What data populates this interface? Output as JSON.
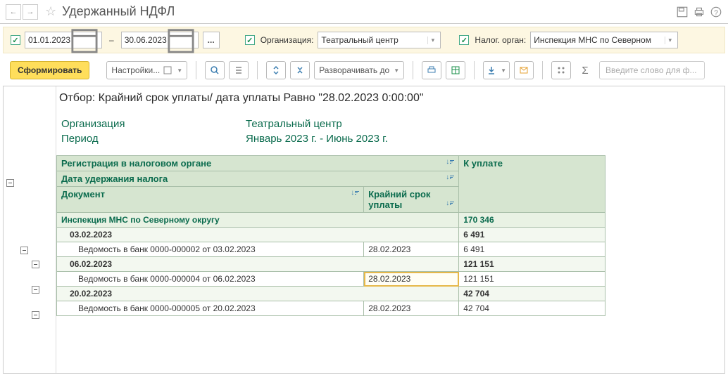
{
  "titlebar": {
    "title": "Удержанный НДФЛ",
    "nav_back": "←",
    "nav_fwd": "→"
  },
  "filter": {
    "date_from": "01.01.2023",
    "date_to": "30.06.2023",
    "dash": "–",
    "org_label": "Организация:",
    "org_value": "Театральный центр",
    "tax_label": "Налог. орган:",
    "tax_value": "Инспекция МНС по Северном"
  },
  "toolbar": {
    "form": "Сформировать",
    "settings": "Настройки...",
    "expand": "Разворачивать до",
    "search_ph": "Введите слово для ф..."
  },
  "report": {
    "filter_text": "Отбор: Крайний срок уплаты/ дата уплаты Равно \"28.02.2023 0:00:00\"",
    "org_label": "Организация",
    "org_value": "Театральный центр",
    "period_label": "Период",
    "period_value": "Январь 2023 г. - Июнь 2023 г.",
    "col_reg": "Регистрация в налоговом органе",
    "col_date": "Дата удержания налога",
    "col_doc": "Документ",
    "col_deadline": "Крайний срок уплаты",
    "col_due": "К уплате",
    "groups": [
      {
        "name": "Инспекция МНС по Северному округу",
        "amount": "170 346",
        "dates": [
          {
            "date": "03.02.2023",
            "amount": "6 491",
            "docs": [
              {
                "name": "Ведомость в банк 0000-000002 от 03.02.2023",
                "deadline": "28.02.2023",
                "amount": "6 491"
              }
            ]
          },
          {
            "date": "06.02.2023",
            "amount": "121 151",
            "docs": [
              {
                "name": "Ведомость в банк 0000-000004 от 06.02.2023",
                "deadline": "28.02.2023",
                "amount": "121 151",
                "selected": true
              }
            ]
          },
          {
            "date": "20.02.2023",
            "amount": "42 704",
            "docs": [
              {
                "name": "Ведомость в банк 0000-000005 от 20.02.2023",
                "deadline": "28.02.2023",
                "amount": "42 704"
              }
            ]
          }
        ]
      }
    ]
  }
}
